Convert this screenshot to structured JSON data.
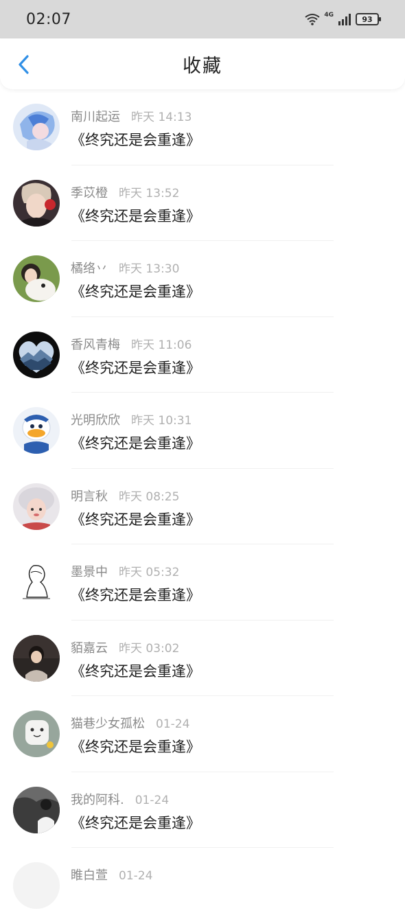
{
  "status": {
    "time": "02:07",
    "network": "4G",
    "battery": "93"
  },
  "header": {
    "title": "收藏"
  },
  "items": [
    {
      "name": "南川起运",
      "time": "昨天 14:13",
      "title": "《终究还是会重逢》",
      "avatar": "anime-girl-blue"
    },
    {
      "name": "季苡橙",
      "time": "昨天 13:52",
      "title": "《终究还是会重逢》",
      "avatar": "boy-rose"
    },
    {
      "name": "橘络丷",
      "time": "昨天 13:30",
      "title": "《终究还是会重逢》",
      "avatar": "girl-dog"
    },
    {
      "name": "香风青梅",
      "time": "昨天 11:06",
      "title": "《终究还是会重逢》",
      "avatar": "heart-mountains"
    },
    {
      "name": "光明欣欣",
      "time": "昨天 10:31",
      "title": "《终究还是会重逢》",
      "avatar": "duck-cartoon"
    },
    {
      "name": "明言秋",
      "time": "昨天 08:25",
      "title": "《终究还是会重逢》",
      "avatar": "girl-fur-hat"
    },
    {
      "name": "墨景中",
      "time": "昨天 05:32",
      "title": "《终究还是会重逢》",
      "avatar": "sketch-figure"
    },
    {
      "name": "貊嘉云",
      "time": "昨天 03:02",
      "title": "《终究还是会重逢》",
      "avatar": "boy-brick-wall"
    },
    {
      "name": "猫巷少女孤松",
      "time": "01-24",
      "title": "《终究还是会重逢》",
      "avatar": "cat-hug"
    },
    {
      "name": "我的阿科.",
      "time": "01-24",
      "title": "《终究还是会重逢》",
      "avatar": "bw-photo"
    },
    {
      "name": "睢白萱",
      "time": "01-24",
      "title": "",
      "avatar": "partial"
    }
  ]
}
